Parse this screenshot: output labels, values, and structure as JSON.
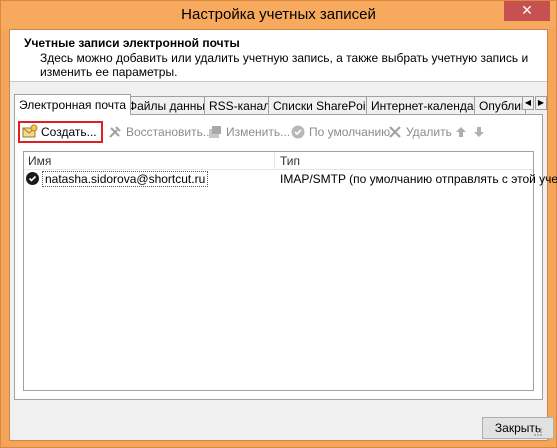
{
  "window": {
    "title": "Настройка учетных записей",
    "close_glyph": "✕"
  },
  "header": {
    "title": "Учетные записи электронной почты",
    "description": "Здесь можно добавить или удалить учетную запись, а также выбрать учетную запись и изменить ее параметры."
  },
  "tabs": [
    {
      "label": "Электронная почта",
      "active": true
    },
    {
      "label": "Файлы данных",
      "active": false
    },
    {
      "label": "RSS-каналы",
      "active": false
    },
    {
      "label": "Списки SharePoint",
      "active": false
    },
    {
      "label": "Интернет-календари",
      "active": false
    },
    {
      "label": "Опублико",
      "active": false
    }
  ],
  "tab_scroll": {
    "left": "◀",
    "right": "▶"
  },
  "toolbar": {
    "create": "Создать...",
    "restore": "Восстановить...",
    "change": "Изменить...",
    "default": "По умолчанию",
    "delete": "Удалить",
    "up_icon": "arrow-up-icon",
    "down_icon": "arrow-down-icon"
  },
  "list": {
    "columns": [
      "Имя",
      "Тип"
    ],
    "rows": [
      {
        "name": "natasha.sidorova@shortcut.ru",
        "type": "IMAP/SMTP (по умолчанию отправлять с этой уче..."
      }
    ]
  },
  "footer": {
    "close_button": "Закрыть"
  },
  "colors": {
    "window_border": "#f5a55a",
    "highlight": "#e02020",
    "close_button": "#c75050"
  }
}
